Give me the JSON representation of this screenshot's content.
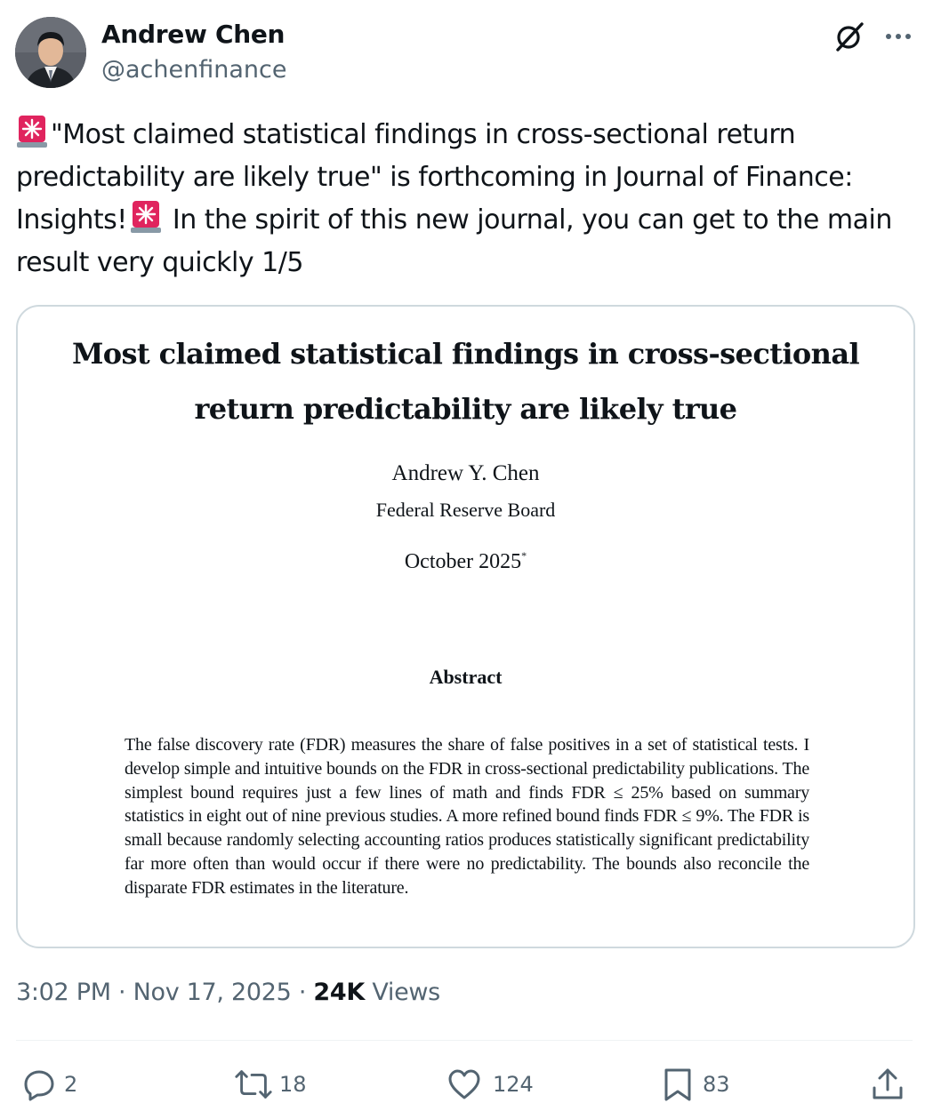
{
  "author": {
    "name": "Andrew Chen",
    "handle": "@achenfinance"
  },
  "tweet": {
    "line1": "\"Most claimed statistical findings in cross-sectional return predictability are likely true\" is forthcoming in Journal of Finance: Insights!",
    "line2": " In the spirit of this new journal, you can get to the main result very quickly 1/5"
  },
  "paper": {
    "title_line1": "Most claimed statistical findings in cross-sectional",
    "title_line2": "return predictability are likely true",
    "author": "Andrew Y. Chen",
    "affiliation": "Federal Reserve Board",
    "date": "October 2025",
    "date_mark": "*",
    "abstract_heading": "Abstract",
    "abstract": "The false discovery rate (FDR) measures the share of false positives in a set of statistical tests. I develop simple and intuitive bounds on the FDR in cross-sectional predictability publications. The simplest bound requires just a few lines of math and finds FDR ≤ 25% based on summary statistics in eight out of nine previous studies. A more refined bound finds FDR ≤ 9%. The FDR is small because randomly selecting accounting ratios produces statistically significant predictability far more often than would occur if there were no predictability. The bounds also reconcile the disparate FDR estimates in the literature."
  },
  "meta": {
    "time": "3:02 PM",
    "separator": "·",
    "date": "Nov 17, 2025",
    "views_count": "24K",
    "views_label": "Views"
  },
  "actions": {
    "replies": "2",
    "reposts": "18",
    "likes": "124",
    "bookmarks": "83"
  },
  "colors": {
    "text": "#0f1419",
    "secondary": "#536471",
    "border": "#cfd9de",
    "siren": "#e0245e"
  },
  "icons": [
    "grok-icon",
    "more-icon",
    "siren-emoji-icon",
    "reply-icon",
    "repost-icon",
    "like-icon",
    "bookmark-icon",
    "share-icon"
  ]
}
